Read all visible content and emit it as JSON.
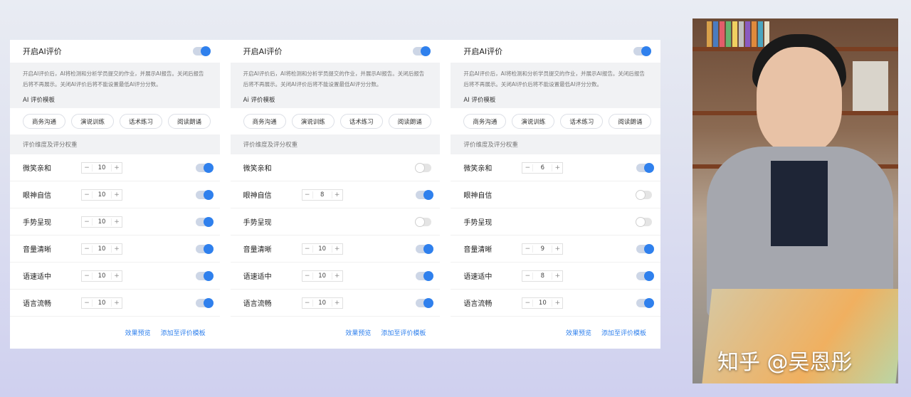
{
  "colors": {
    "accent": "#2f80ed"
  },
  "panels": [
    {
      "header_title": "开启AI评价",
      "header_toggle_on": true,
      "description": "开启AI评价后，AI将检测和分析学员提交的作业，并展示AI报告。关闭后报告后将不再展示。关闭AI评价后将不能设置最低AI评分分数。",
      "template_title": "AI 评价模板",
      "templates": [
        "商务沟通",
        "演说训练",
        "话术练习",
        "阅读朗诵"
      ],
      "dimension_title": "评价维度及评分权重",
      "rows": [
        {
          "label": "微笑亲和",
          "value": "10",
          "on": true
        },
        {
          "label": "眼神自信",
          "value": "10",
          "on": true
        },
        {
          "label": "手势呈现",
          "value": "10",
          "on": true
        },
        {
          "label": "音量清晰",
          "value": "10",
          "on": true
        },
        {
          "label": "语速适中",
          "value": "10",
          "on": true
        },
        {
          "label": "语言流畅",
          "value": "10",
          "on": true
        }
      ],
      "footer_preview": "效果预览",
      "footer_add": "添加至评价模板"
    },
    {
      "header_title": "开启AI评价",
      "header_toggle_on": true,
      "description": "开启AI评价后，AI将检测和分析学员提交的作业，并展示AI报告。关闭后报告后将不再展示。关闭AI评价后将不能设置最低AI评分分数。",
      "template_title": "Ai 评价模板",
      "templates": [
        "商务沟通",
        "演说训练",
        "话术练习",
        "阅读朗诵"
      ],
      "dimension_title": "评价维度及评分权重",
      "rows": [
        {
          "label": "微笑亲和",
          "value": "",
          "on": false
        },
        {
          "label": "眼神自信",
          "value": "8",
          "on": true
        },
        {
          "label": "手势呈现",
          "value": "",
          "on": false
        },
        {
          "label": "音量清晰",
          "value": "10",
          "on": true
        },
        {
          "label": "语速适中",
          "value": "10",
          "on": true
        },
        {
          "label": "语言流畅",
          "value": "10",
          "on": true
        }
      ],
      "footer_preview": "效果预览",
      "footer_add": "添加至评价模板"
    },
    {
      "header_title": "开启AI评价",
      "header_toggle_on": true,
      "description": "开启AI评价后，AI将检测和分析学员提交的作业，并展示AI报告。关闭后报告后将不再展示。关闭AI评价后将不能设置最低AI评分分数。",
      "template_title": "AI 评价模板",
      "templates": [
        "商务沟通",
        "演说训练",
        "话术练习",
        "阅读朗诵"
      ],
      "dimension_title": "评价维度及评分权重",
      "rows": [
        {
          "label": "微笑亲和",
          "value": "6",
          "on": true
        },
        {
          "label": "眼神自信",
          "value": "",
          "on": false
        },
        {
          "label": "手势呈现",
          "value": "",
          "on": false
        },
        {
          "label": "音量清晰",
          "value": "9",
          "on": true
        },
        {
          "label": "语速适中",
          "value": "8",
          "on": true
        },
        {
          "label": "语言流畅",
          "value": "10",
          "on": true
        }
      ],
      "footer_preview": "效果预览",
      "footer_add": "添加至评价模板"
    }
  ],
  "stepper": {
    "minus": "−",
    "plus": "+"
  },
  "watermark": "知乎 @吴恩彤"
}
